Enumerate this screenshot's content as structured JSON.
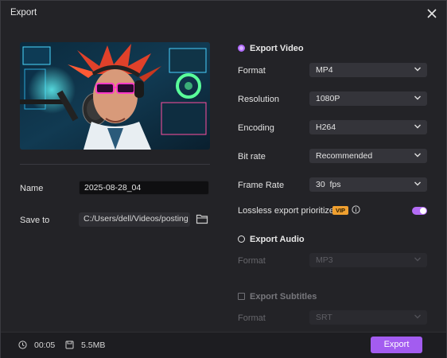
{
  "window": {
    "title": "Export"
  },
  "left": {
    "name_label": "Name",
    "name_value": "2025-08-28_04",
    "save_label": "Save to",
    "save_path": "C:/Users/dell/Videos/posting"
  },
  "export_video": {
    "label": "Export Video",
    "selected": true,
    "rows": [
      {
        "label": "Format",
        "value": "MP4"
      },
      {
        "label": "Resolution",
        "value": "1080P"
      },
      {
        "label": "Encoding",
        "value": "H264"
      },
      {
        "label": "Bit rate",
        "value": "Recommended"
      },
      {
        "label": "Frame Rate",
        "value": "30  fps"
      }
    ],
    "lossless_label": "Lossless export prioritized",
    "vip_badge": "VIP",
    "lossless_enabled": true
  },
  "export_audio": {
    "label": "Export Audio",
    "selected": false,
    "format_label": "Format",
    "format_value": "MP3"
  },
  "export_subtitles": {
    "label": "Export Subtitles",
    "checked": false,
    "format_label": "Format",
    "format_value": "SRT"
  },
  "footer": {
    "duration": "00:05",
    "size": "5.5MB",
    "export_button": "Export"
  },
  "colors": {
    "accent": "#a35cf0",
    "vip": "#f0a030",
    "background": "#232327"
  }
}
